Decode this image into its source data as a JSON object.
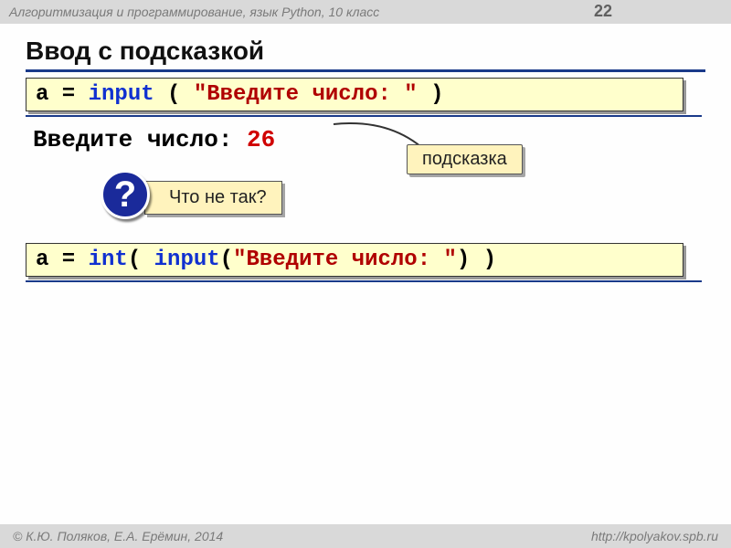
{
  "header": {
    "course": "Алгоритмизация и программирование, язык Python, 10 класс",
    "page": "22"
  },
  "title": "Ввод с подсказкой",
  "code1": {
    "p1": "a = ",
    "kw": "input",
    "p2": " ( ",
    "str": "\"Введите число: \"",
    "p3": " )"
  },
  "console": {
    "prompt": "Введите число: ",
    "value": "26"
  },
  "hint": "подсказка",
  "question": {
    "mark": "?",
    "text": "Что не так?"
  },
  "code2": {
    "p1": "a = ",
    "kw1": "int",
    "p2": "( ",
    "kw2": "input",
    "p3": "(",
    "str": "\"Введите число: \"",
    "p4": ") )"
  },
  "footer": {
    "authors": "© К.Ю. Поляков, Е.А. Ерёмин, 2014",
    "site": "http://kpolyakov.spb.ru"
  }
}
